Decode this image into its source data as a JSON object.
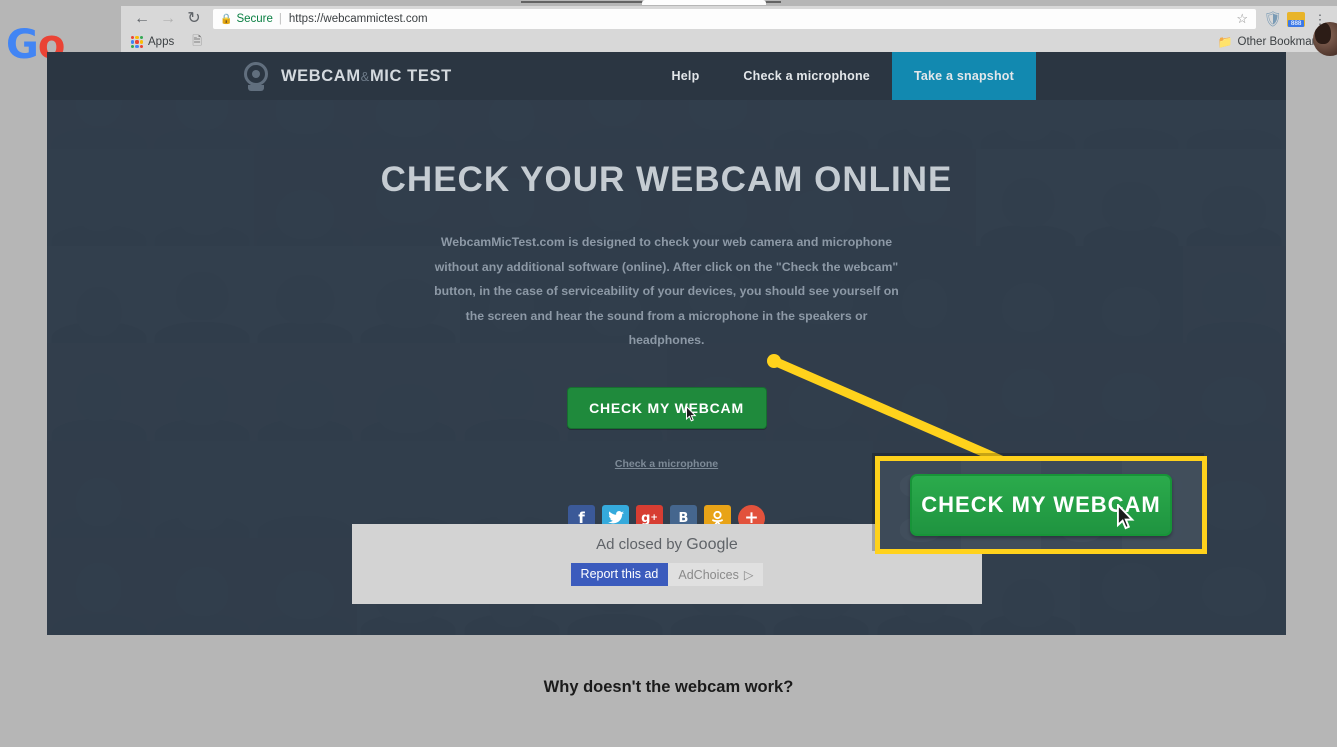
{
  "browser": {
    "back_icon": "back-arrow-icon",
    "forward_icon": "forward-arrow-icon",
    "reload_icon": "reload-icon",
    "security_label": "Secure",
    "url": "https://webcammictest.com",
    "lock_icon": "lock-icon",
    "star_icon": "bookmark-star-icon",
    "shield_icon": "shield-extension-icon",
    "badge_text": "888",
    "menu_icon": "three-dot-menu-icon",
    "apps_label": "Apps",
    "other_bookmarks_label": "Other Bookmarks",
    "google_logo": "Go"
  },
  "site": {
    "logo_main": "WEBCAM",
    "logo_amp": "&",
    "logo_secondary": "MIC TEST",
    "nav": [
      {
        "label": "Help",
        "active": false
      },
      {
        "label": "Check a microphone",
        "active": false
      },
      {
        "label": "Take a snapshot",
        "active": true
      }
    ]
  },
  "hero": {
    "title": "CHECK YOUR WEBCAM ONLINE",
    "description": "WebcamMicTest.com is designed to check your web camera and microphone without any additional software (online). After click on the \"Check the webcam\" button, in the case of serviceability of your devices, you should see yourself on the screen and hear the sound from a microphone in the speakers or headphones.",
    "primary_button": "CHECK MY WEBCAM",
    "microphone_link": "Check a microphone",
    "social": [
      {
        "name": "facebook",
        "glyph": "f",
        "color": "#3b5998"
      },
      {
        "name": "twitter",
        "glyph": "ᵗ",
        "color": "#35aadc"
      },
      {
        "name": "google-plus",
        "glyph": "g+",
        "color": "#d73d32"
      },
      {
        "name": "vkontakte",
        "glyph": "B",
        "color": "#45668e"
      },
      {
        "name": "odnoklassniki",
        "glyph": "๏",
        "color": "#e8a317"
      },
      {
        "name": "share-more",
        "glyph": "+",
        "color": "#e2523c"
      }
    ]
  },
  "ad": {
    "closed_text": "Ad closed by",
    "google_word": "Google",
    "report_label": "Report this ad",
    "adchoices_label": "AdChoices",
    "adchoices_icon": "adchoices-triangle-icon"
  },
  "callout": {
    "button_label": "CHECK MY WEBCAM",
    "border_color": "#ffd21c",
    "cursor_icon": "mouse-pointer-icon"
  },
  "below": {
    "heading": "Why doesn't the webcam work?"
  },
  "colors": {
    "header_bg": "#2b3642",
    "nav_active": "#1289b0",
    "green_button": "#1f8a3c",
    "highlight_yellow": "#ffd21c",
    "page_bg": "#b6b6b6"
  }
}
